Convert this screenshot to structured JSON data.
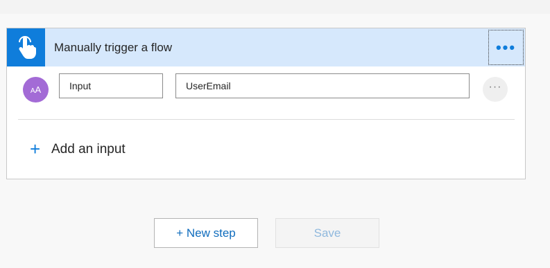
{
  "trigger": {
    "title": "Manually trigger a flow",
    "icon": "hand-touch-icon",
    "more_label": "•••"
  },
  "input_row": {
    "avatar_label_small": "A",
    "avatar_label_large": "A",
    "name_value": "Input",
    "value_value": "UserEmail",
    "more_label": "···"
  },
  "add_input": {
    "plus": "+",
    "label": "Add an input"
  },
  "footer": {
    "new_step_label": "+ New step",
    "save_label": "Save"
  },
  "colors": {
    "accent": "#0f7ddb",
    "header_bg": "#d6e8fc",
    "avatar": "#a36bd6"
  }
}
